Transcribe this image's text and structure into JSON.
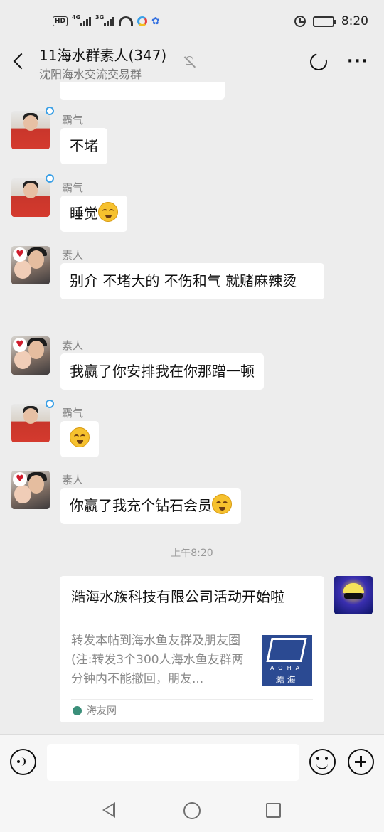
{
  "status_bar": {
    "hd_label": "HD",
    "network_4g": "4G",
    "network_3g": "3G",
    "time": "8:20",
    "battery_level": 0.85
  },
  "header": {
    "title": "11海水群素人(347)",
    "subtitle": "沈阳海水交流交易群"
  },
  "messages": [
    {
      "sender": "霸气",
      "text": "不堵",
      "emoji": false
    },
    {
      "sender": "霸气",
      "text": "睡觉",
      "emoji": true
    },
    {
      "sender": "素人",
      "text": "别介 不堵大的 不伤和气 就赌麻辣烫",
      "emoji": false
    },
    {
      "sender": "素人",
      "text": "我赢了你安排我在你那蹭一顿",
      "emoji": false
    },
    {
      "sender": "霸气",
      "text": "",
      "emoji": true
    },
    {
      "sender": "素人",
      "text": "你赢了我充个钻石会员",
      "emoji": true
    }
  ],
  "timestamp": "上午8:20",
  "card": {
    "title": "澔海水族科技有限公司活动开始啦",
    "description": "转发本帖到海水鱼友群及朋友圈(注:转发3个300人海水鱼友群两分钟内不能撤回，朋友...",
    "thumb_letters": "AOHA",
    "thumb_name": "澔海",
    "source": "海友网"
  },
  "input": {
    "placeholder": ""
  },
  "colors": {
    "background": "#ededed",
    "bubble": "#ffffff",
    "accent_ring": "#3ba0e6"
  },
  "icons": [
    "back-arrow-icon",
    "mute-bell-icon",
    "refresh-icon",
    "more-icon",
    "voice-icon",
    "emoji-icon",
    "plus-icon"
  ]
}
